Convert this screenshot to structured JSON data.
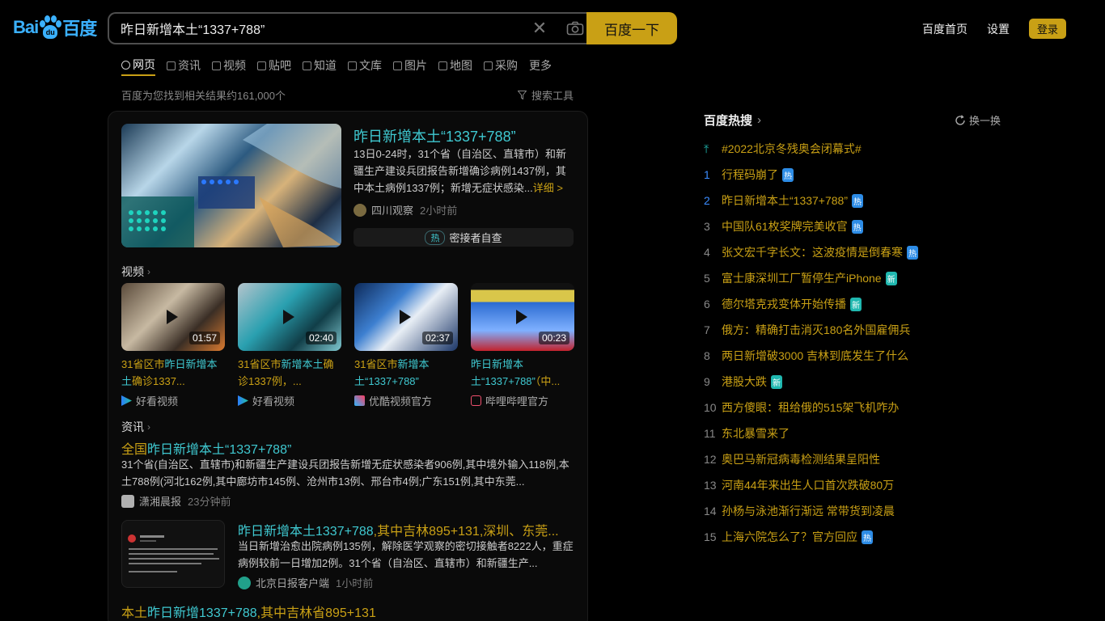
{
  "header": {
    "logo_text_left": "Bai",
    "logo_text_right": "百度",
    "logo_paw_text": "du",
    "search_value": "昨日新增本土“1337+788”",
    "search_button": "百度一下",
    "links": [
      "百度首页",
      "设置"
    ],
    "login": "登录"
  },
  "tabs": [
    "网页",
    "资讯",
    "视频",
    "贴吧",
    "知道",
    "文库",
    "图片",
    "地图",
    "采购",
    "更多"
  ],
  "result_count": "百度为您找到相关结果约161,000个",
  "search_tools": "搜索工具",
  "hero": {
    "title": "昨日新增本土“1337+788”",
    "desc": "13日0-24时，31个省（自治区、直辖市）和新疆生产建设兵团报告新增确诊病例1437例，其中本土病例1337例；新增无症状感染...",
    "more": "详细 >",
    "source": "四川观察",
    "time": "2小时前",
    "hot_pill": "热",
    "hot_text": "密接者自查"
  },
  "videos_section": "视频",
  "videos": [
    {
      "dur": "01:57",
      "title_a": "31省区市",
      "title_hl": "昨日新增本土",
      "title_b": "确诊1337...",
      "source": "好看视频"
    },
    {
      "dur": "02:40",
      "title_a": "31省区市",
      "title_hl": "新增本土",
      "title_b": "确诊1337例，...",
      "source": "好看视频"
    },
    {
      "dur": "02:37",
      "title_a": "31省区市",
      "title_hl": "新增本土“1337+788”",
      "title_b": "",
      "source": "优酷视频官方"
    },
    {
      "dur": "00:23",
      "title_a": "",
      "title_hl": "昨日新增本土“1337+788”",
      "title_b": "（中...",
      "source": "哔哩哔哩官方"
    }
  ],
  "news_section": "资讯",
  "news": [
    {
      "title_a": "全国",
      "title_hl": "昨日新增本土“1337+788”",
      "title_b": "",
      "desc": "31个省(自治区、直辖市)和新疆生产建设兵团报告新增无症状感染者906例,其中境外输入118例,本土788例(河北162例,其中廊坊市145例、沧州市13例、邢台市4例;广东151例,其中东莞...",
      "source": "潇湘晨报",
      "time": "23分钟前"
    },
    {
      "title_a": "",
      "title_hl": "昨日新增本土1337+788",
      "title_b": ",其中吉林895+131,深圳、东莞...",
      "desc": "当日新增治愈出院病例135例，解除医学观察的密切接触者8222人，重症病例较前一日增加2例。31个省（自治区、直辖市）和新疆生产...",
      "source": "北京日报客户端",
      "time": "1小时前"
    },
    {
      "title_a": "本土",
      "title_hl": "昨日新增1337+788",
      "title_b": ",其中吉林省895+131"
    }
  ],
  "hotlist": {
    "title": "百度热搜",
    "refresh": "换一换",
    "items": [
      {
        "num": "",
        "text": "#2022北京冬残奥会闭幕式#",
        "badge": ""
      },
      {
        "num": "1",
        "text": "行程码崩了",
        "badge": "热"
      },
      {
        "num": "2",
        "text": "昨日新增本土“1337+788”",
        "badge": "热"
      },
      {
        "num": "3",
        "text": "中国队61枚奖牌完美收官",
        "badge": "热"
      },
      {
        "num": "4",
        "text": "张文宏千字长文：这波疫情是倒春寒",
        "badge": "热"
      },
      {
        "num": "5",
        "text": "富士康深圳工厂暂停生产iPhone",
        "badge": "新"
      },
      {
        "num": "6",
        "text": "德尔塔克戎变体开始传播",
        "badge": "新"
      },
      {
        "num": "7",
        "text": "俄方：精确打击消灭180名外国雇佣兵",
        "badge": ""
      },
      {
        "num": "8",
        "text": "两日新增破3000 吉林到底发生了什么",
        "badge": ""
      },
      {
        "num": "9",
        "text": "港股大跌",
        "badge": "新"
      },
      {
        "num": "10",
        "text": "西方傻眼：租给俄的515架飞机咋办",
        "badge": ""
      },
      {
        "num": "11",
        "text": "东北暴雪来了",
        "badge": ""
      },
      {
        "num": "12",
        "text": "奥巴马新冠病毒检测结果呈阳性",
        "badge": ""
      },
      {
        "num": "13",
        "text": "河南44年来出生人口首次跌破80万",
        "badge": ""
      },
      {
        "num": "14",
        "text": "孙杨与泳池渐行渐远 常带货到凌晨",
        "badge": ""
      },
      {
        "num": "15",
        "text": "上海六院怎么了？官方回应",
        "badge": "热"
      }
    ]
  }
}
